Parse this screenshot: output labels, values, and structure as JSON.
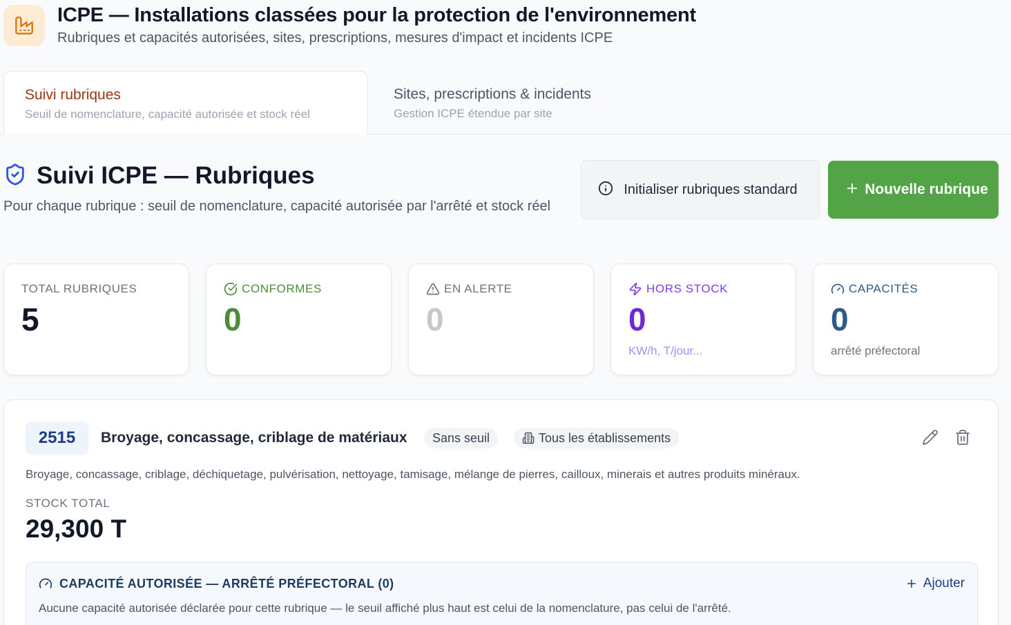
{
  "header": {
    "title": "ICPE — Installations classées pour la protection de l'environnement",
    "subtitle": "Rubriques et capacités autorisées, sites, prescriptions, mesures d'impact et incidents ICPE",
    "logo_icon": "factory-icon"
  },
  "tabs": [
    {
      "label": "Suivi rubriques",
      "sub": "Seuil de nomenclature, capacité autorisée et stock réel",
      "active": true
    },
    {
      "label": "Sites, prescriptions & incidents",
      "sub": "Gestion ICPE étendue par site",
      "active": false
    }
  ],
  "section": {
    "title": "Suivi ICPE — Rubriques",
    "description": "Pour chaque rubrique : seuil de nomenclature, capacité autorisée par l'arrêté et stock réel",
    "title_icon": "shield-check-icon"
  },
  "buttons": {
    "init_label": "Initialiser rubriques standard",
    "new_label": "Nouvelle rubrique"
  },
  "stats": [
    {
      "label": "TOTAL RUBRIQUES",
      "value": "5",
      "note": "",
      "icon": "",
      "color": "#111827",
      "label_color": "#6b7280",
      "note_color": ""
    },
    {
      "label": "CONFORMES",
      "value": "0",
      "note": "",
      "icon": "check-circle-icon",
      "color": "#4d8a3a",
      "label_color": "#4d8a3a",
      "note_color": ""
    },
    {
      "label": "EN ALERTE",
      "value": "0",
      "note": "",
      "icon": "alert-triangle-icon",
      "color": "#c4c7cc",
      "label_color": "#6b7280",
      "note_color": ""
    },
    {
      "label": "HORS STOCK",
      "value": "0",
      "note": "KW/h, T/jour...",
      "icon": "zap-icon",
      "color": "#6d28d9",
      "label_color": "#7e3af2",
      "note_color": "#a78bfa"
    },
    {
      "label": "CAPACITÉS",
      "value": "0",
      "note": "arrêté préfectoral",
      "icon": "gauge-icon",
      "color": "#2c5a8c",
      "label_color": "#2c5a8c",
      "note_color": "#6b7280"
    }
  ],
  "rubrique": {
    "code": "2515",
    "title": "Broyage, concassage, criblage de matériaux",
    "seuil_badge": "Sans seuil",
    "etablissement_badge": "Tous les établissements",
    "description": "Broyage, concassage, criblage, déchiquetage, pulvérisation, nettoyage, tamisage, mélange de pierres, cailloux, minerais et autres produits minéraux.",
    "stock_label": "STOCK TOTAL",
    "stock_value": "29,300 T",
    "capacity": {
      "title": "CAPACITÉ AUTORISÉE — ARRÊTÉ PRÉFECTORAL (0)",
      "add_label": "Ajouter",
      "note": "Aucune capacité autorisée déclarée pour cette rubrique — le seuil affiché plus haut est celui de la nomenclature, pas celui de l'arrêté."
    }
  },
  "colors": {
    "accent_green": "#52a447",
    "active_tab": "#9a3412",
    "logo_bg": "#fdebd3",
    "logo_fg": "#d97706"
  }
}
